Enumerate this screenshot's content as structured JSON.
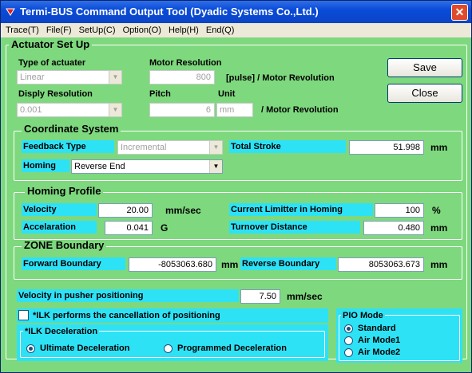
{
  "window": {
    "title": "Termi-BUS Command Output Tool (Dyadic Systems Co.,Ltd.)",
    "close_glyph": "✕"
  },
  "menu": [
    "Trace(T)",
    "File(F)",
    "SetUp(C)",
    "Option(O)",
    "Help(H)",
    "End(Q)"
  ],
  "actuator": {
    "title": "Actuator Set Up",
    "type_label": "Type of actuater",
    "type_value": "Linear",
    "motor_res_label": "Motor Resolution",
    "motor_res_value": "800",
    "motor_res_unit": "[pulse]  / Motor Revolution",
    "disp_res_label": "Disply Resolution",
    "disp_res_value": "0.001",
    "pitch_label": "Pitch",
    "pitch_value": "6",
    "unit_label": "Unit",
    "unit_value": "mm",
    "pitch_unit": "/ Motor Revolution"
  },
  "buttons": {
    "save": "Save",
    "close": "Close"
  },
  "coord": {
    "title": "Coordinate System",
    "feedback_label": "Feedback Type",
    "feedback_value": "Incremental",
    "total_stroke_label": "Total Stroke",
    "total_stroke_value": "51.998",
    "total_stroke_unit": "mm",
    "homing_label": "Homing",
    "homing_value": "Reverse End"
  },
  "homing": {
    "title": "Homing Profile",
    "velocity_label": "Velocity",
    "velocity_value": "20.00",
    "velocity_unit": "mm/sec",
    "current_label": "Current Limitter in Homing",
    "current_value": "100",
    "current_unit": "%",
    "accel_label": "Accelaration",
    "accel_value": "0.041",
    "accel_unit": "G",
    "turnover_label": "Turnover Distance",
    "turnover_value": "0.480",
    "turnover_unit": "mm"
  },
  "zone": {
    "title": "ZONE Boundary",
    "forward_label": "Forward Boundary",
    "forward_value": "-8053063.680",
    "forward_unit": "mm",
    "reverse_label": "Reverse Boundary",
    "reverse_value": "8053063.673",
    "reverse_unit": "mm"
  },
  "pusher": {
    "label": "Velocity in pusher positioning",
    "value": "7.50",
    "unit": "mm/sec"
  },
  "ilk": {
    "checkbox_label": "*ILK performs the cancellation of positioning",
    "decel_title": "*ILK Deceleration",
    "ultimate": "Ultimate Deceleration",
    "programmed": "Programmed Deceleration"
  },
  "pio": {
    "title": "PIO Mode",
    "standard": "Standard",
    "air1": "Air Mode1",
    "air2": "Air Mode2"
  },
  "colors": {
    "panel": "#7ed87e",
    "label_bg": "#2ee2f6",
    "titlebar": "#0a4bd8"
  }
}
